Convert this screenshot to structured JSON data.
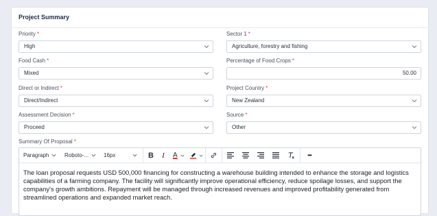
{
  "section": {
    "title": "Project Summary"
  },
  "fields": {
    "priority": {
      "label": "Priority",
      "value": "High"
    },
    "sector": {
      "label": "Sector 1",
      "value": "Agriculture, forestry and fishing"
    },
    "food_cash": {
      "label": "Food Cash",
      "value": "Mixed"
    },
    "food_crops_pct": {
      "label": "Percentage of Food Crops",
      "value": "50.00"
    },
    "direct_indirect": {
      "label": "Direct or Indirect",
      "value": "Direct/Indirect"
    },
    "project_country": {
      "label": "Project Country",
      "value": "New Zealand"
    },
    "assessment_decision": {
      "label": "Assessment Decision",
      "value": "Proceed"
    },
    "source": {
      "label": "Source",
      "value": "Other"
    }
  },
  "required_marker": "*",
  "summary": {
    "label": "Summary Of Proposal",
    "toolbar": {
      "paragraph": "Paragraph",
      "font": "Roboto-...",
      "size": "16px",
      "bold": "B",
      "italic": "I",
      "underline_color": "A",
      "more": "•••"
    },
    "text": "The loan proposal requests USD 500,000 financing for constructing a warehouse building intended to enhance the storage and logistics capabilities of a farming company. The facility will significantly improve operational efficiency, reduce spoilage losses, and support the company's growth ambitions. Repayment will be managed through increased revenues and improved profitability generated from streamlined operations and expanded market reach."
  },
  "colors": {
    "required": "#e0403c",
    "accent_underline": "#d23a2f",
    "page_background": "#e9ecf3"
  }
}
